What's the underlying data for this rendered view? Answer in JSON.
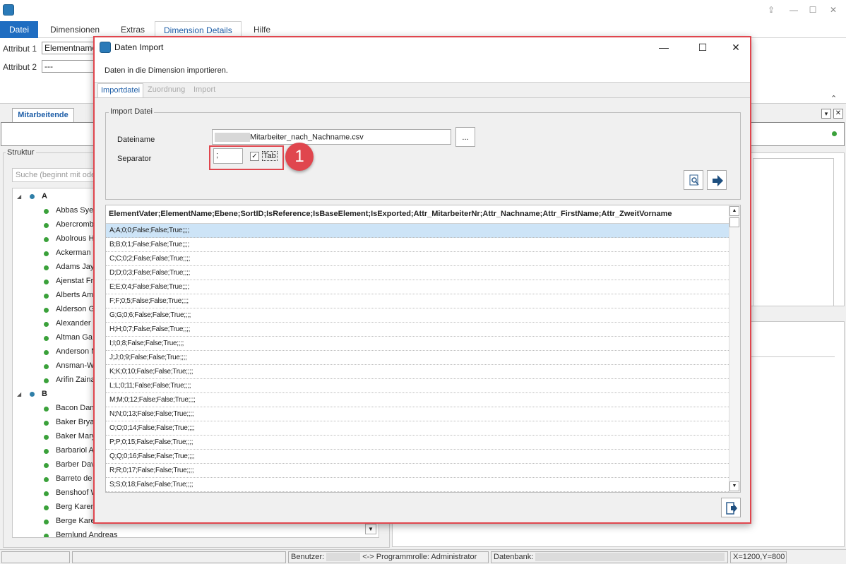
{
  "app": {
    "menu": [
      "Datei",
      "Dimensionen",
      "Extras",
      "Dimension Details",
      "Hilfe"
    ],
    "attributes": [
      {
        "label": "Attribut 1",
        "value": "Elementname"
      },
      {
        "label": "Attribut 2",
        "value": "---"
      }
    ],
    "panel_tab": "Mitarbeitende",
    "struktur_label": "Struktur",
    "search_placeholder": "Suche (beginnt mit oder",
    "tree": [
      {
        "group": "A",
        "items": [
          "Abbas Syed",
          "Abercromb",
          "Abolrous H",
          "Ackerman",
          "Adams Jay",
          "Ajenstat Fr",
          "Alberts Am",
          "Alderson G",
          "Alexander",
          "Altman Ga",
          "Anderson N",
          "Ansman-W",
          "Arifin Zaina"
        ]
      },
      {
        "group": "B",
        "items": [
          "Bacon Dan",
          "Baker Bryar",
          "Baker Mary",
          "Barbariol A",
          "Barber Dav",
          "Barreto de",
          "Benshoof W",
          "Berg Karen",
          "Berge Kare",
          "Bernlund Andreas"
        ]
      }
    ]
  },
  "dialog": {
    "title": "Daten Import",
    "description": "Daten in die Dimension importieren.",
    "tabs": [
      "Importdatei",
      "Zuordnung",
      "Import"
    ],
    "group_label": "Import Datei",
    "dateiname_label": "Dateiname",
    "filename": "Mitarbeiter_nach_Nachname.csv",
    "browse_label": "...",
    "separator_label": "Separator",
    "separator_value": ";",
    "tab_checkbox_label": "Tab",
    "tab_checked": true,
    "badge": "1",
    "grid_header": "ElementVater;ElementName;Ebene;SortID;IsReference;IsBaseElement;IsExported;Attr_MitarbeiterNr;Attr_Nachname;Attr_FirstName;Attr_ZweitVorname",
    "grid_rows": [
      "A;A;0;0;False;False;True;;;;",
      "B;B;0;1;False;False;True;;;;",
      "C;C;0;2;False;False;True;;;;",
      "D;D;0;3;False;False;True;;;;",
      "E;E;0;4;False;False;True;;;;",
      "F;F;0;5;False;False;True;;;;",
      "G;G;0;6;False;False;True;;;;",
      "H;H;0;7;False;False;True;;;;",
      "I;I;0;8;False;False;True;;;;",
      "J;J;0;9;False;False;True;;;;",
      "K;K;0;10;False;False;True;;;;",
      "L;L;0;11;False;False;True;;;;",
      "M;M;0;12;False;False;True;;;;",
      "N;N;0;13;False;False;True;;;;",
      "O;O;0;14;False;False;True;;;;",
      "P;P;0;15;False;False;True;;;;",
      "Q;Q;0;16;False;False;True;;;;",
      "R;R;0;17;False;False;True;;;;",
      "S;S;0;18;False;False;True;;;;"
    ]
  },
  "status": {
    "benutzer_label": "Benutzer:",
    "arrows": "<->",
    "role": "Programmrolle: Administrator",
    "datenbank_label": "Datenbank:",
    "coords": "X=1200,Y=800"
  },
  "colors": {
    "accent": "#1f6dc1",
    "highlight": "#e0464e",
    "status_dot": "#3aa13a"
  }
}
